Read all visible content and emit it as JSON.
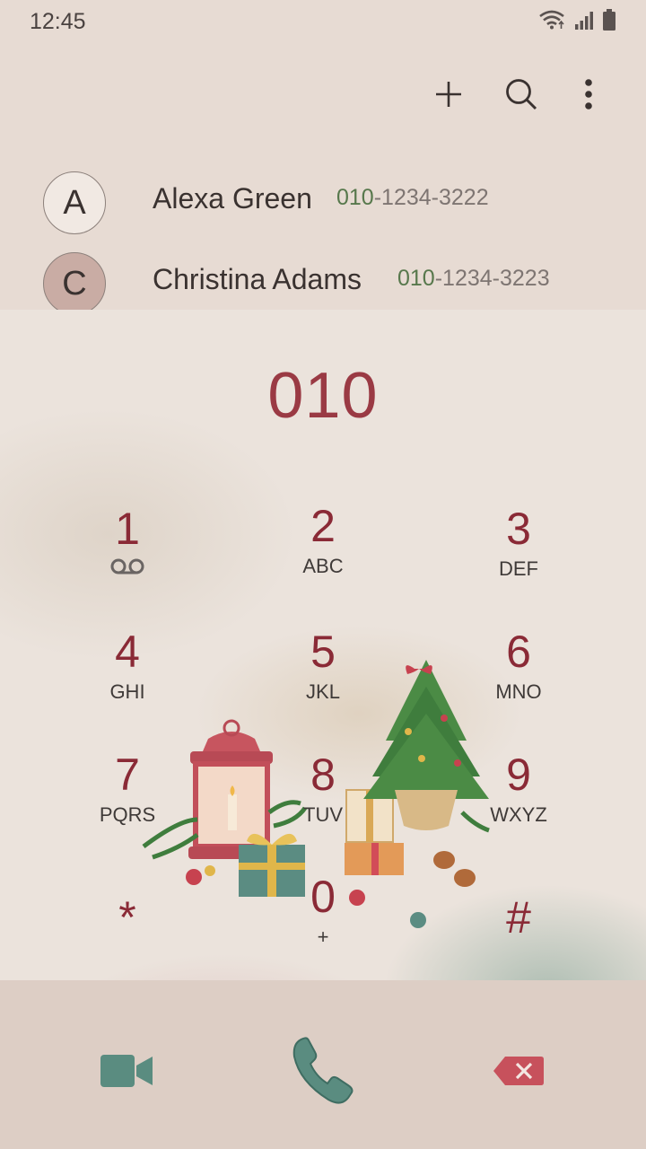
{
  "status_bar": {
    "time": "12:45",
    "icons": [
      "wifi-icon",
      "signal-icon",
      "battery-icon"
    ]
  },
  "action_bar": {
    "actions": [
      "add-icon",
      "search-icon",
      "more-options-icon"
    ]
  },
  "contacts": [
    {
      "initial": "A",
      "name": "Alexa Green",
      "number_match": "010",
      "number_rest": "-1234-3222"
    },
    {
      "initial": "C",
      "name": "Christina Adams",
      "number_match": "010",
      "number_rest": "-1234-3223"
    }
  ],
  "dialpad": {
    "dialed": "010",
    "keys": [
      {
        "digit": "1",
        "letters": ""
      },
      {
        "digit": "2",
        "letters": "ABC"
      },
      {
        "digit": "3",
        "letters": "DEF"
      },
      {
        "digit": "4",
        "letters": "GHI"
      },
      {
        "digit": "5",
        "letters": "JKL"
      },
      {
        "digit": "6",
        "letters": "MNO"
      },
      {
        "digit": "7",
        "letters": "PQRS"
      },
      {
        "digit": "8",
        "letters": "TUV"
      },
      {
        "digit": "9",
        "letters": "WXYZ"
      },
      {
        "digit": "*",
        "letters": ""
      },
      {
        "digit": "0",
        "letters": "+"
      },
      {
        "digit": "#",
        "letters": ""
      }
    ]
  },
  "bottom_bar": {
    "actions": [
      "video-call-icon",
      "phone-icon",
      "backspace-icon"
    ]
  },
  "colors": {
    "accent": "#8a2a36",
    "match": "#57784c",
    "call": "#5a8c80"
  }
}
